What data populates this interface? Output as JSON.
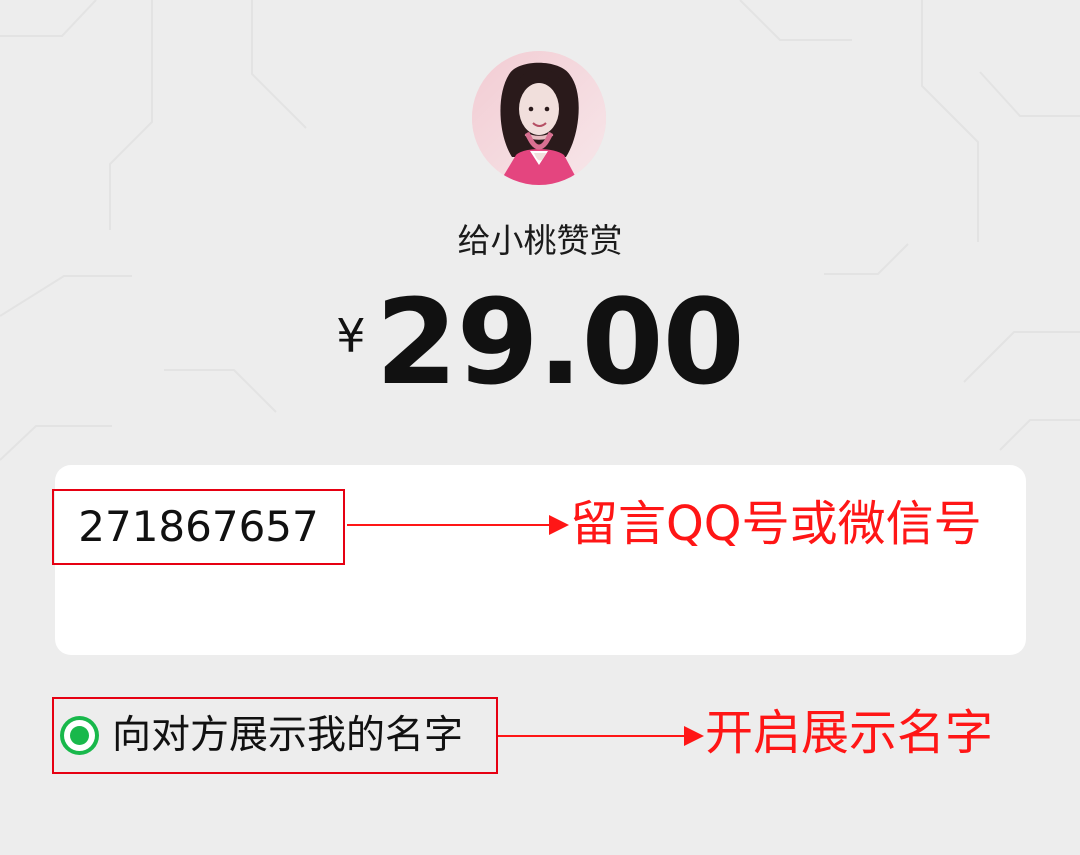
{
  "profile": {
    "recipient_label": "给小桃赞赏",
    "avatar_alt": "avatar"
  },
  "payment": {
    "currency_symbol": "¥",
    "amount": "29.00"
  },
  "message": {
    "value": "271867657"
  },
  "annotations": {
    "message_note": "留言QQ号或微信号",
    "toggle_note": "开启展示名字"
  },
  "show_name": {
    "label": "向对方展示我的名字",
    "checked": true
  },
  "colors": {
    "background": "#ededed",
    "card": "#ffffff",
    "annotation_red": "#ff1616",
    "radio_green": "#18b84b",
    "text": "#111111"
  }
}
